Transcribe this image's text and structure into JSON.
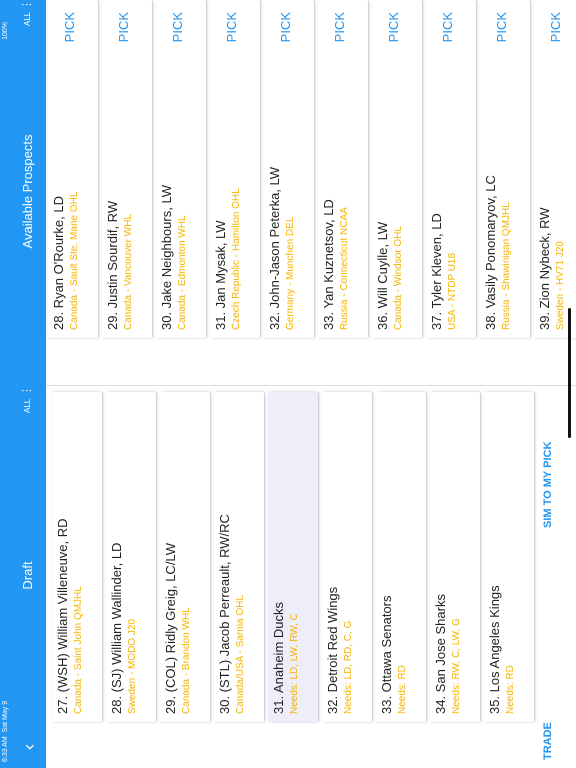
{
  "status": {
    "time": "6:33 AM",
    "date": "Sat May 9",
    "battery": "100%"
  },
  "header": {
    "back_icon": "chevron-left-icon",
    "draft_title": "Draft",
    "available_title": "Available Prospects",
    "filter_label": "ALL",
    "filter_label_right": "ALL"
  },
  "draft": [
    {
      "name": "27. (WSH) William Villeneuve, RD",
      "sub": "Canada - Saint John QMJHL"
    },
    {
      "name": "28. (SJ) William Wallinder, LD",
      "sub": "Sweden - MODO J20"
    },
    {
      "name": "29. (COL) Ridly Greig, LC/LW",
      "sub": "Canada - Brandon WHL"
    },
    {
      "name": "30. (STL) Jacob Perreault, RW/RC",
      "sub": "Canada/USA - Sarnia OHL"
    },
    {
      "name": "31. Anaheim Ducks",
      "sub": "Needs: LD, LW, RW, C"
    },
    {
      "name": "32. Detroit Red Wings",
      "sub": "Needs: LD, RD, C, G"
    },
    {
      "name": "33. Ottawa Senators",
      "sub": "Needs: RD"
    },
    {
      "name": "34. San Jose Sharks",
      "sub": "Needs: RW, C, LW, G"
    },
    {
      "name": "35. Los Angeles Kings",
      "sub": "Needs: RD"
    }
  ],
  "prospects": [
    {
      "name": "28. Ryan O'Rourke, LD",
      "sub": "Canada - Sault Ste. Marie OHL",
      "pick": "PICK"
    },
    {
      "name": "29. Justin Sourdif, RW",
      "sub": "Canada - Vancouver WHL",
      "pick": "PICK"
    },
    {
      "name": "30. Jake Neighbours, LW",
      "sub": "Canada - Edmonton WHL",
      "pick": "PICK"
    },
    {
      "name": "31. Jan Mysak, LW",
      "sub": "Czech Republic - Hamilton OHL",
      "pick": "PICK"
    },
    {
      "name": "32. John-Jason Peterka, LW",
      "sub": "Germany - Munchen DEL",
      "pick": "PICK"
    },
    {
      "name": "33. Yan Kuznetsov, LD",
      "sub": "Russia - Connecticut NCAA",
      "pick": "PICK"
    },
    {
      "name": "36. Will Cuylle, LW",
      "sub": "Canada - Windsor OHL",
      "pick": "PICK"
    },
    {
      "name": "37. Tyler Kleven, LD",
      "sub": "USA - NTDP U18",
      "pick": "PICK"
    },
    {
      "name": "38. Vasily Ponomaryov, LC",
      "sub": "Russia - Shawinigan QMJHL",
      "pick": "PICK"
    },
    {
      "name": "39. Zion Nybeck, RW",
      "sub": "Sweden - HV71 J20",
      "pick": "PICK"
    }
  ],
  "footer": {
    "trade_label": "TRADE",
    "sim_label": "SIM TO MY PICK"
  },
  "colors": {
    "accent": "#2196f3",
    "subtext": "#f5b400",
    "highlight": "#eeedfa"
  }
}
